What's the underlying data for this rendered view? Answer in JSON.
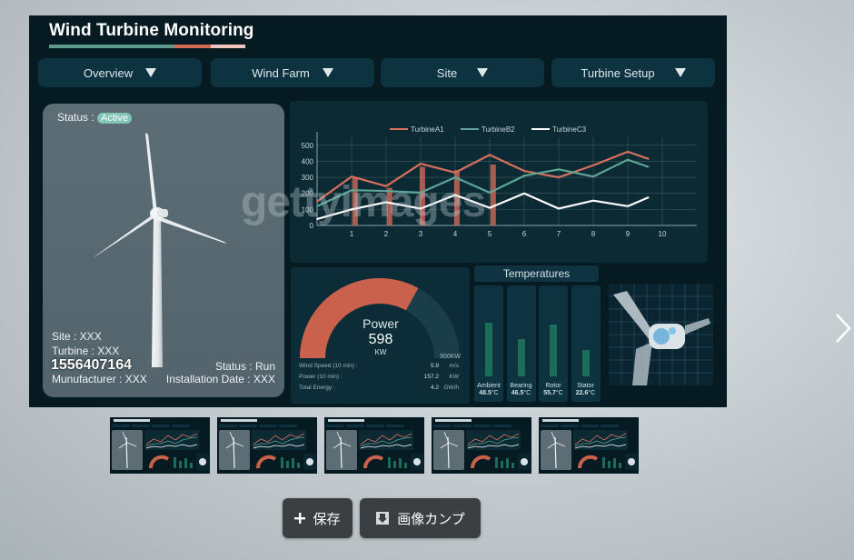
{
  "dashboard": {
    "title": "Wind Turbine Monitoring",
    "underline_colors": [
      "#5b9c8c",
      "#d46a55",
      "#f1c7bd"
    ],
    "nav": [
      {
        "label": "Overview"
      },
      {
        "label": "Wind Farm"
      },
      {
        "label": "Site"
      },
      {
        "label": "Turbine Setup"
      }
    ],
    "turbine": {
      "status_label": "Status :",
      "status_value": "Active",
      "site": "Site : XXX",
      "turbine": "Turbine : XXX",
      "manufacturer": "Munufacturer : XXX",
      "run_status": "Status : Run",
      "installation_date": "Installation Date : XXX"
    },
    "power": {
      "title": "Power",
      "value": "598",
      "unit": "KW",
      "max_label": "900KW",
      "gauge_fraction": 0.66,
      "rows": [
        {
          "label": "Wind Speed (10 min) :",
          "value": "5.9",
          "unit": "m/s"
        },
        {
          "label": "Power (10 min) :",
          "value": "157.2",
          "unit": "KW"
        },
        {
          "label": "Total Energy :",
          "value": "4.2",
          "unit": "GW/h"
        }
      ]
    },
    "temperatures": {
      "title": "Temperatures",
      "items": [
        {
          "name": "Ambient",
          "value": "48.5",
          "unit": "°C",
          "level": 0.62
        },
        {
          "name": "Bearing",
          "value": "46.5",
          "unit": "°C",
          "level": 0.43
        },
        {
          "name": "Rotor",
          "value": "55.7",
          "unit": "°C",
          "level": 0.6
        },
        {
          "name": "Stator",
          "value": "22.6",
          "unit": "°C",
          "level": 0.3
        }
      ]
    }
  },
  "watermark": "gettyimages",
  "image_id": "1556407164",
  "buttons": {
    "save": "保存",
    "comp": "画像カンプ"
  },
  "chart_data": {
    "type": "line",
    "title": "",
    "xlabel": "",
    "ylabel": "",
    "x": [
      0,
      1,
      2,
      3,
      4,
      5,
      6,
      7,
      8,
      9,
      9.6
    ],
    "x_ticks": [
      1,
      2,
      3,
      4,
      5,
      6,
      7,
      8,
      9,
      10
    ],
    "y_ticks": [
      0,
      100,
      200,
      300,
      400,
      500
    ],
    "xlim": [
      0,
      11
    ],
    "ylim": [
      0,
      550
    ],
    "legend_position": "top",
    "grid": true,
    "series": [
      {
        "name": "TurbineA1",
        "color": "#d8705f",
        "values": [
          150,
          305,
          245,
          385,
          330,
          440,
          340,
          300,
          375,
          460,
          415
        ]
      },
      {
        "name": "TurbineB2",
        "color": "#5da596",
        "values": [
          120,
          220,
          215,
          205,
          300,
          205,
          310,
          350,
          305,
          410,
          365
        ]
      },
      {
        "name": "TurbineC3",
        "color": "#ffffff",
        "values": [
          40,
          100,
          145,
          105,
          190,
          110,
          200,
          105,
          155,
          120,
          175
        ]
      }
    ],
    "bars": {
      "color": "#c76556",
      "x": [
        1.1,
        2.1,
        3.05,
        4.05,
        5.1
      ],
      "values": [
        300,
        235,
        365,
        345,
        380
      ]
    }
  }
}
